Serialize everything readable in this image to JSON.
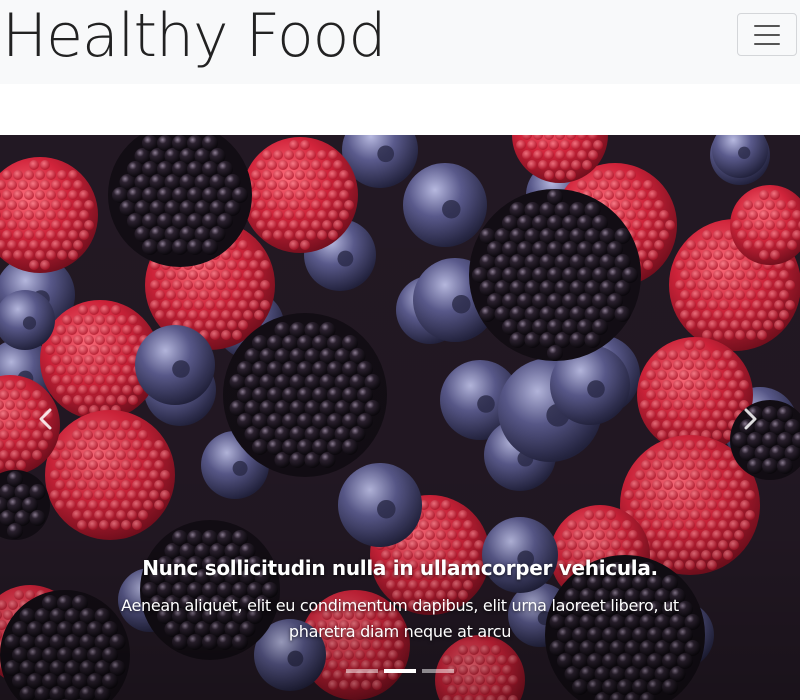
{
  "navbar": {
    "brand": "Healthy Food",
    "toggler_icon": "hamburger-icon"
  },
  "carousel": {
    "image_subject": "raspberries, blueberries and blackberries",
    "prev_icon": "chevron-left-icon",
    "next_icon": "chevron-right-icon",
    "caption": {
      "title": "Nunc sollicitudin nulla in ullamcorper vehicula.",
      "text": "Aenean aliquet, elit eu condimentum dapibus, elit urna laoreet libero, ut pharetra diam neque at arcu"
    },
    "indicators": [
      {
        "active": false
      },
      {
        "active": true
      },
      {
        "active": false
      }
    ]
  },
  "colors": {
    "navbar_bg": "#f8f9fa",
    "raspberry": "#d1233a",
    "blueberry": "#5a5a8c",
    "blackberry": "#1c1620"
  }
}
